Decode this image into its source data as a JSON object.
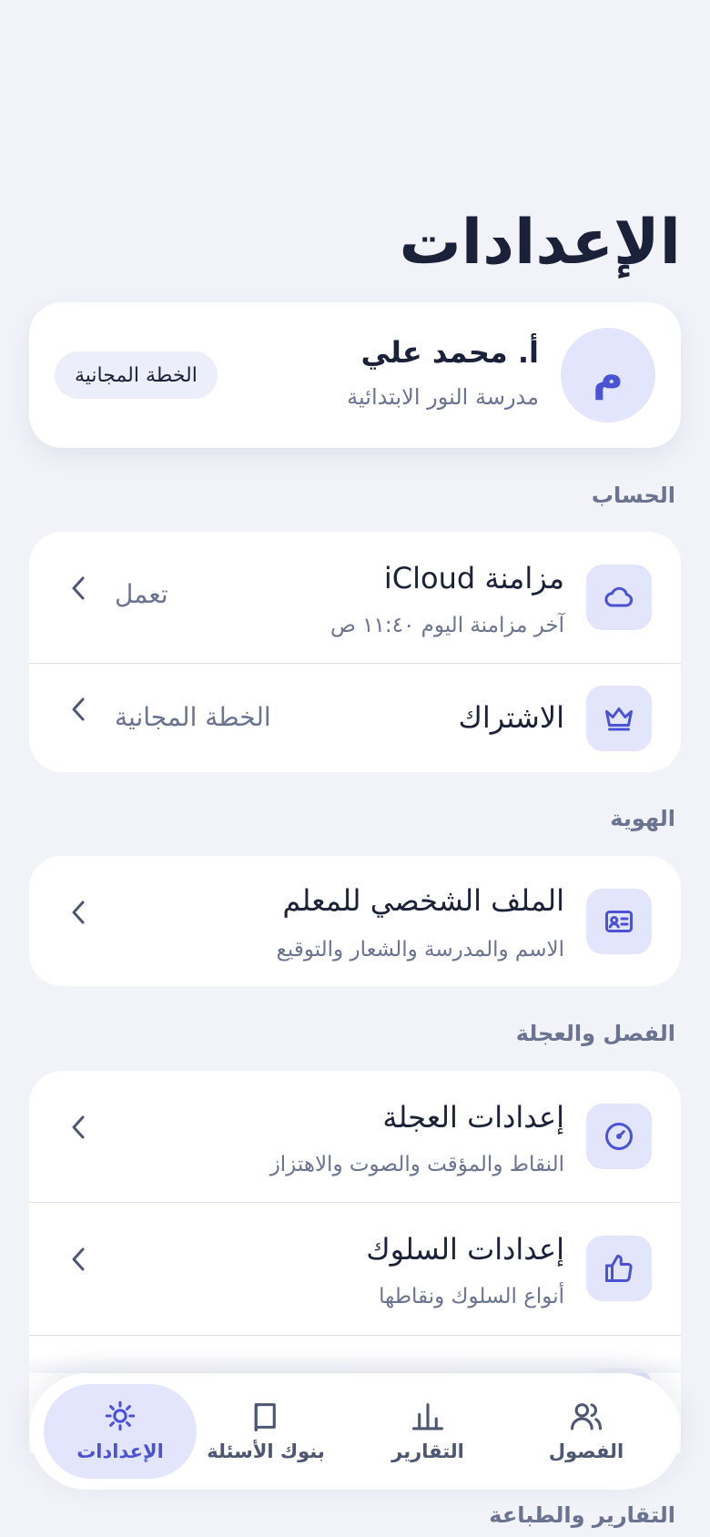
{
  "page": {
    "title": "الإعدادات"
  },
  "profile": {
    "avatar_letter": "م",
    "name": "أ. محمد علي",
    "school": "مدرسة النور الابتدائية",
    "plan_badge": "الخطة المجانية"
  },
  "sections": {
    "account": {
      "title": "الحساب",
      "icloud": {
        "title": "مزامنة iCloud",
        "subtitle": "آخر مزامنة اليوم ١١:٤٠ ص",
        "value": "تعمل",
        "icon": "cloud-icon"
      },
      "subscription": {
        "title": "الاشتراك",
        "value": "الخطة المجانية",
        "icon": "crown-icon"
      }
    },
    "identity": {
      "title": "الهوية",
      "teacher_profile": {
        "title": "الملف الشخصي للمعلم",
        "subtitle": "الاسم والمدرسة والشعار والتوقيع",
        "icon": "id-card-icon"
      }
    },
    "class_wheel": {
      "title": "الفصل والعجلة",
      "wheel_settings": {
        "title": "إعدادات العجلة",
        "subtitle": "النقاط والمؤقت والصوت والاهتزاز",
        "icon": "gauge-icon"
      },
      "behavior_settings": {
        "title": "إعدادات السلوك",
        "subtitle": "أنواع السلوك ونقاطها",
        "icon": "thumbs-up-icon"
      }
    },
    "reports_printing": {
      "title": "التقارير والطباعة"
    }
  },
  "tabbar": {
    "classes": "الفصول",
    "reports": "التقارير",
    "question_banks": "بنوك الأسئلة",
    "settings": "الإعدادات"
  },
  "colors": {
    "background": "#f2f3f9",
    "accent": "#4a52d6",
    "accent_soft": "#e2e5fb",
    "text_primary": "#1a2138",
    "text_secondary": "#6a7390"
  }
}
